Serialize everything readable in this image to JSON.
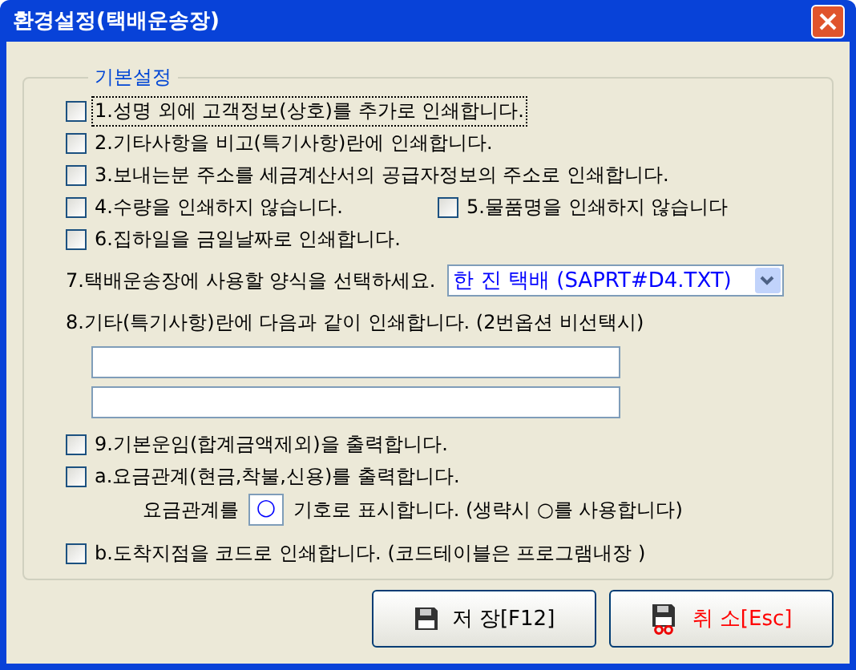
{
  "window": {
    "title": "환경설정(택배운송장)"
  },
  "group": {
    "title": "기본설정"
  },
  "options": [
    {
      "kind": "checkbox",
      "label": "1.성명 외에 고객정보(상호)를 추가로 인쇄합니다.",
      "checked": false,
      "focused": true
    },
    {
      "kind": "checkbox",
      "label": "2.기타사항을 비고(특기사항)란에 인쇄합니다.",
      "checked": false,
      "focused": false
    },
    {
      "kind": "checkbox",
      "label": "3.보내는분 주소를 세금계산서의 공급자정보의 주소로 인쇄합니다.",
      "checked": false,
      "focused": false
    },
    {
      "kind": "pair",
      "checks": [
        {
          "label": "4.수량을 인쇄하지 않습니다.",
          "checked": false,
          "focused": false
        },
        {
          "label": "5.물품명을 인쇄하지 않습니다",
          "checked": false,
          "focused": false
        }
      ]
    },
    {
      "kind": "checkbox",
      "label": "6.집하일을 금일날짜로 인쇄합니다.",
      "checked": false,
      "focused": false
    },
    {
      "kind": "select",
      "label": "7.택배운송장에 사용할 양식을 선택하세요.",
      "value": "한 진 택배 (SAPRT#D4.TXT)"
    },
    {
      "kind": "text_lines",
      "label": "8.기타(특기사항)란에 다음과 같이 인쇄합니다. (2번옵션 비선택시)",
      "fields": [
        {
          "disabled": false
        },
        {
          "disabled": false
        }
      ]
    },
    {
      "kind": "checkbox",
      "label": "9.기본운임(합계금액제외)을 출력합니다.",
      "checked": false,
      "focused": false
    },
    {
      "kind": "symbol",
      "label": "a.요금관계(현금,착불,신용)를 출력합니다.",
      "checked": false,
      "focused": false,
      "prefix": "요금관계를",
      "symbol": "○",
      "suffix": "기호로 표시합니다. (생략시 ○를 사용합니다)"
    },
    {
      "kind": "checkbox",
      "label": "b.도착지점을 코드로 인쇄합니다. (코드테이블은 프로그램내장 )",
      "checked": false,
      "focused": false
    }
  ],
  "buttons": [
    {
      "kind": "save",
      "label": "저 장[F12]"
    },
    {
      "kind": "cancel",
      "label": "취 소[Esc]"
    }
  ]
}
